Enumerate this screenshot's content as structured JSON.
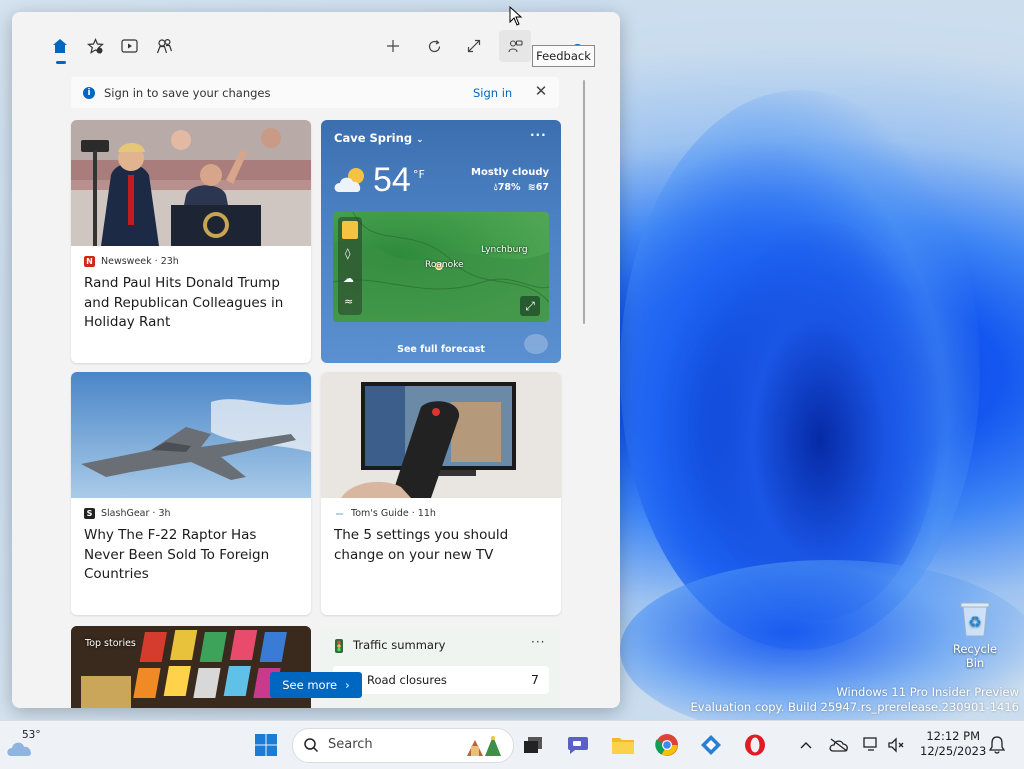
{
  "widget_toolbar": {
    "icons": [
      "home-icon",
      "star-icon",
      "play-icon",
      "people-icon",
      "plus-icon",
      "refresh-icon",
      "expand-icon",
      "feedback-icon"
    ],
    "tooltip": "Feedback",
    "badge": "i"
  },
  "signin_banner": {
    "message": "Sign in to save your changes",
    "link": "Sign in",
    "close": "✕"
  },
  "news": [
    {
      "source": "Newsweek · 23h",
      "headline": "Rand Paul Hits Donald Trump and Republican Colleagues in Holiday Rant",
      "logo": "N",
      "logo_color": "#d0271d"
    },
    {
      "source": "SlashGear · 3h",
      "headline": "Why The F-22 Raptor Has Never Been Sold To Foreign Countries",
      "logo": "S",
      "logo_color": "#222222"
    },
    {
      "source": "Tom's Guide · 11h",
      "headline": "The 5 settings you should change on your new TV",
      "logo": "—",
      "logo_color": "#5aa9d6"
    }
  ],
  "weather_card": {
    "location": "Cave Spring",
    "more": "···",
    "temperature": "54",
    "unit": "°F",
    "condition": "Mostly cloudy",
    "humidity": "78%",
    "aqi": "67",
    "map_labels": [
      "Lynchburg",
      "Roanoke"
    ],
    "forecast_link": "See full forecast"
  },
  "traffic_card": {
    "title": "Traffic summary",
    "more": "···",
    "road_closures_label": "Road closures",
    "road_closures_count": "7"
  },
  "top_stories_label": "Top stories",
  "see_more": "See more",
  "desktop": {
    "recycle_bin": "Recycle Bin",
    "watermark_line1": "Windows 11 Pro Insider Preview",
    "watermark_line2": "Evaluation copy. Build 25947.rs_prerelease.230901-1416"
  },
  "taskbar": {
    "weather_temp": "53°",
    "search_placeholder": "Search",
    "time": "12:12 PM",
    "date": "12/25/2023"
  },
  "colors": {
    "accent": "#0067c0",
    "weather_card": "#4d82c4",
    "taskbar": "#eef2f6"
  }
}
